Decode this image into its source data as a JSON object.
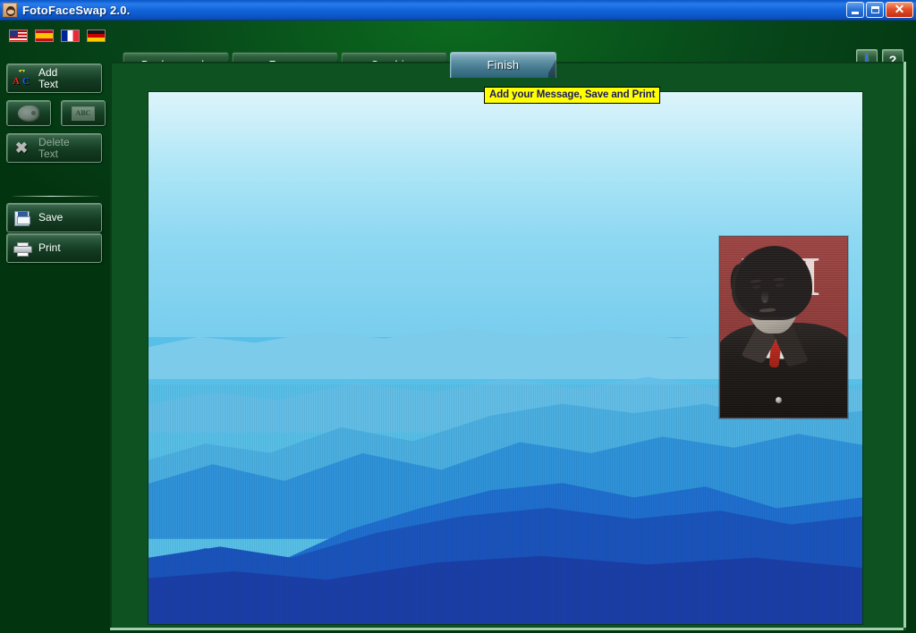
{
  "window": {
    "title": "FotoFaceSwap 2.0.",
    "app_icon": "face-app-icon",
    "buttons": {
      "minimize": "minimize-button",
      "maximize": "maximize-button",
      "close": "close-button"
    }
  },
  "toolbar": {
    "languages": [
      {
        "name": "english",
        "label": "United States",
        "flag": "us"
      },
      {
        "name": "spanish",
        "label": "Spain",
        "flag": "es"
      },
      {
        "name": "french",
        "label": "France",
        "flag": "fr"
      },
      {
        "name": "german",
        "label": "Germany",
        "flag": "de"
      }
    ],
    "tabs": [
      {
        "label": "Backgrounds",
        "active": false
      },
      {
        "label": "Faces",
        "active": false
      },
      {
        "label": "Combine",
        "active": false
      },
      {
        "label": "Finish",
        "active": true
      }
    ],
    "info_label": "i",
    "help_label": "?"
  },
  "sidebar": {
    "items": [
      {
        "label_line1": "Add",
        "label_line2": "Text",
        "icon": "abc-letters-icon",
        "enabled": true
      },
      {
        "label_line1": "",
        "label_line2": "",
        "icon": "color-palette-icon",
        "enabled": false
      },
      {
        "label_line1": "",
        "label_line2": "",
        "icon": "font-box-icon",
        "enabled": false
      },
      {
        "label_line1": "Delete",
        "label_line2": "Text",
        "icon": "x-delete-icon",
        "enabled": false
      },
      {
        "label_line1": "Save",
        "label_line2": "",
        "icon": "floppy-disk-icon",
        "enabled": true
      },
      {
        "label_line1": "Print",
        "label_line2": "",
        "icon": "printer-icon",
        "enabled": true
      }
    ]
  },
  "canvas": {
    "message": "Add your Message, Save and Print",
    "background_image": "blue-layered-mountain-ridges",
    "face_photo": {
      "name": "pasted-face-photo",
      "description": "black-and-white portrait of young man with red tie on red poster background",
      "poster_text": "MI"
    }
  },
  "colors": {
    "titlebar_blue": "#1266dc",
    "panel_green": "#0d5220",
    "body_green": "#07471a",
    "tab_active": "#5a8da0",
    "message_bg": "#ffff00",
    "message_fg": "#1a1a66",
    "border_light_green": "#9fd3ab"
  }
}
